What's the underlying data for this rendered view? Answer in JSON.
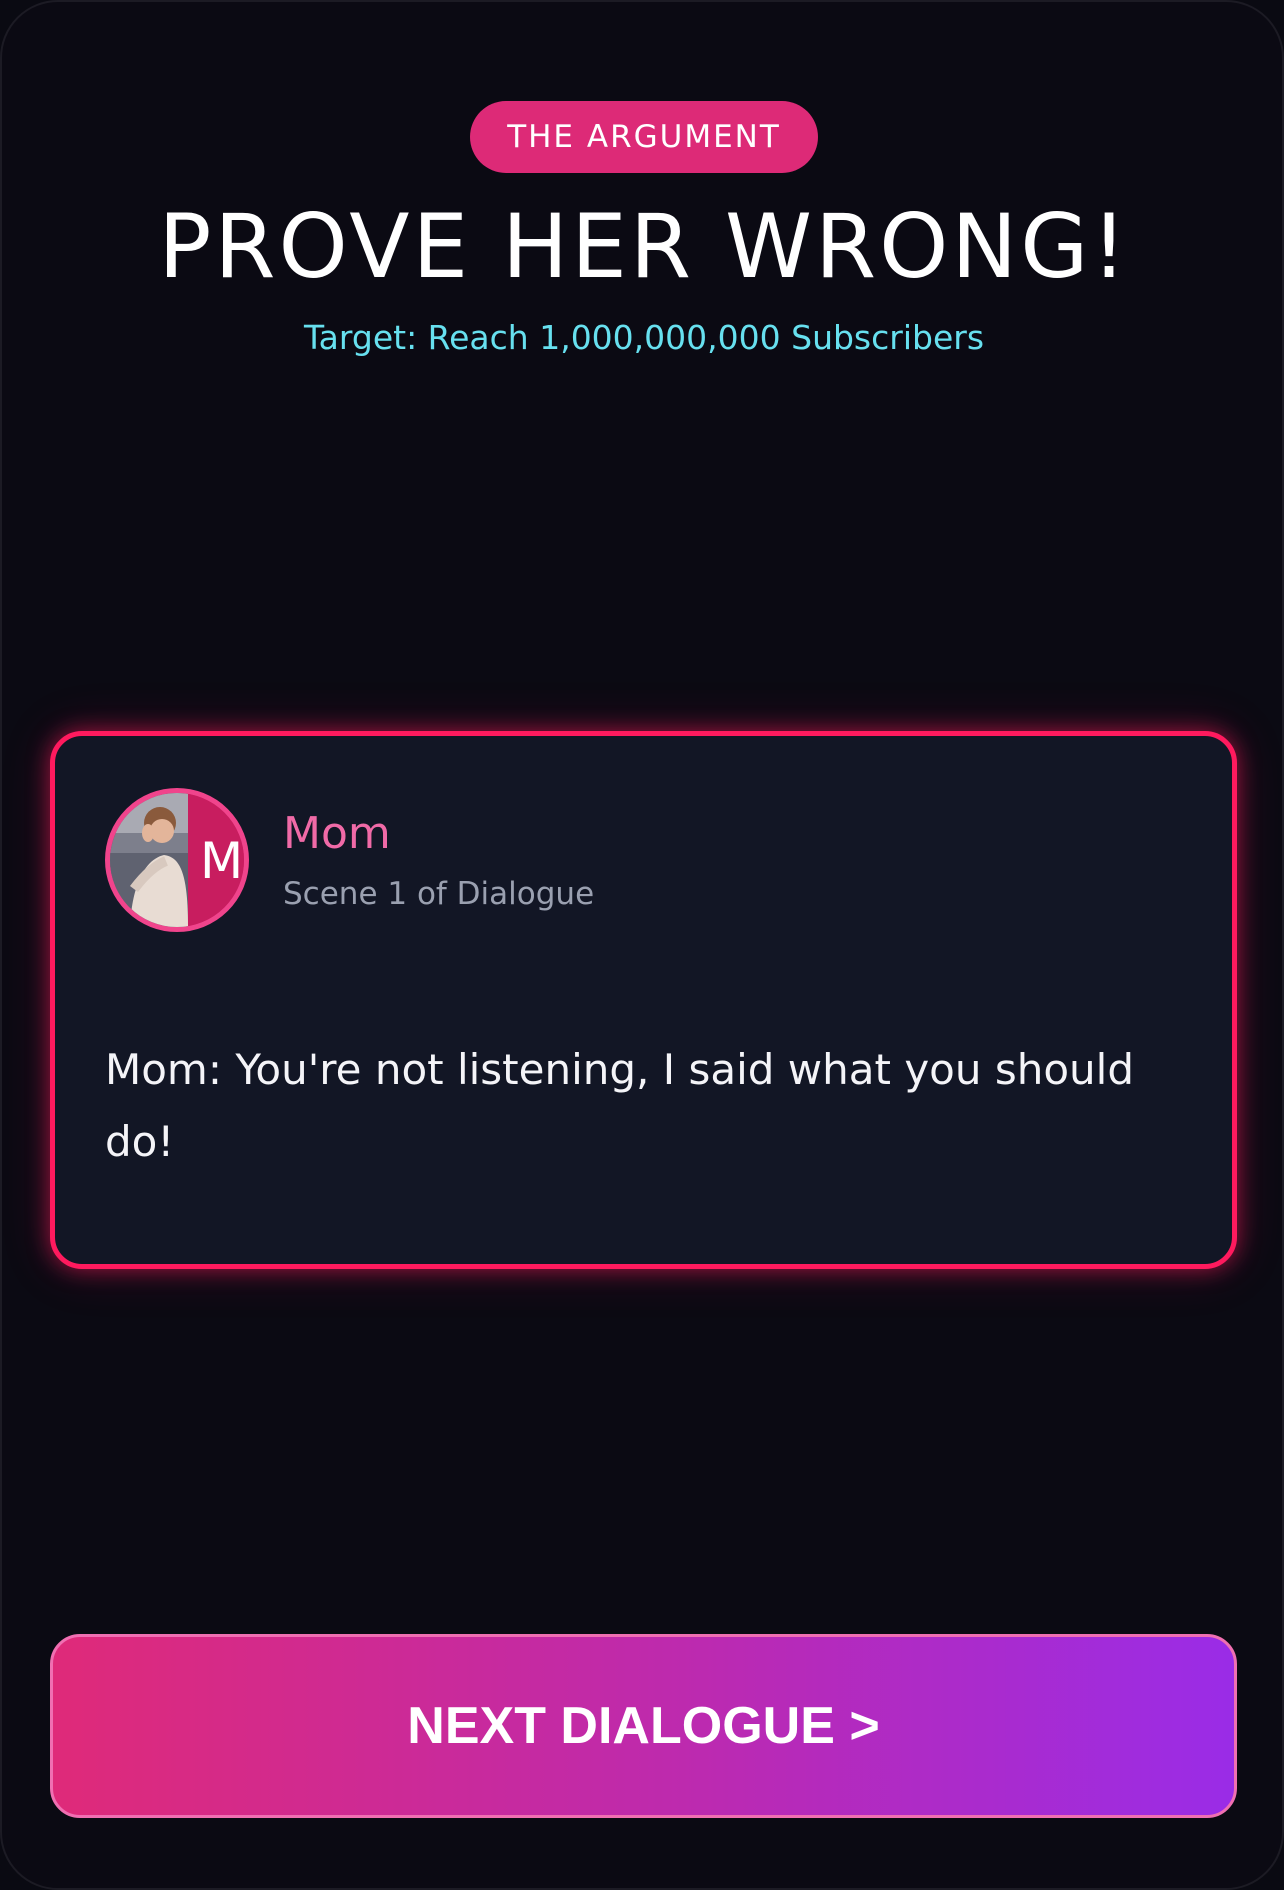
{
  "header": {
    "badge": "THE ARGUMENT",
    "title": "PROVE HER WRONG!",
    "subtitle": "Target: Reach 1,000,000,000 Subscribers"
  },
  "dialogue_card": {
    "avatar_letter": "M",
    "speaker": "Mom",
    "scene_label": "Scene 1 of Dialogue",
    "text": "Mom: You're not listening, I said what you should do!"
  },
  "actions": {
    "next_label": "NEXT DIALOGUE >"
  },
  "colors": {
    "background": "#0b0a13",
    "badge": "#dd2a77",
    "subtitle": "#67e0ef",
    "card_border": "#ff1a5e",
    "speaker": "#f06aa7",
    "button_gradient_start": "#df2a79",
    "button_gradient_end": "#9a2ce7"
  }
}
